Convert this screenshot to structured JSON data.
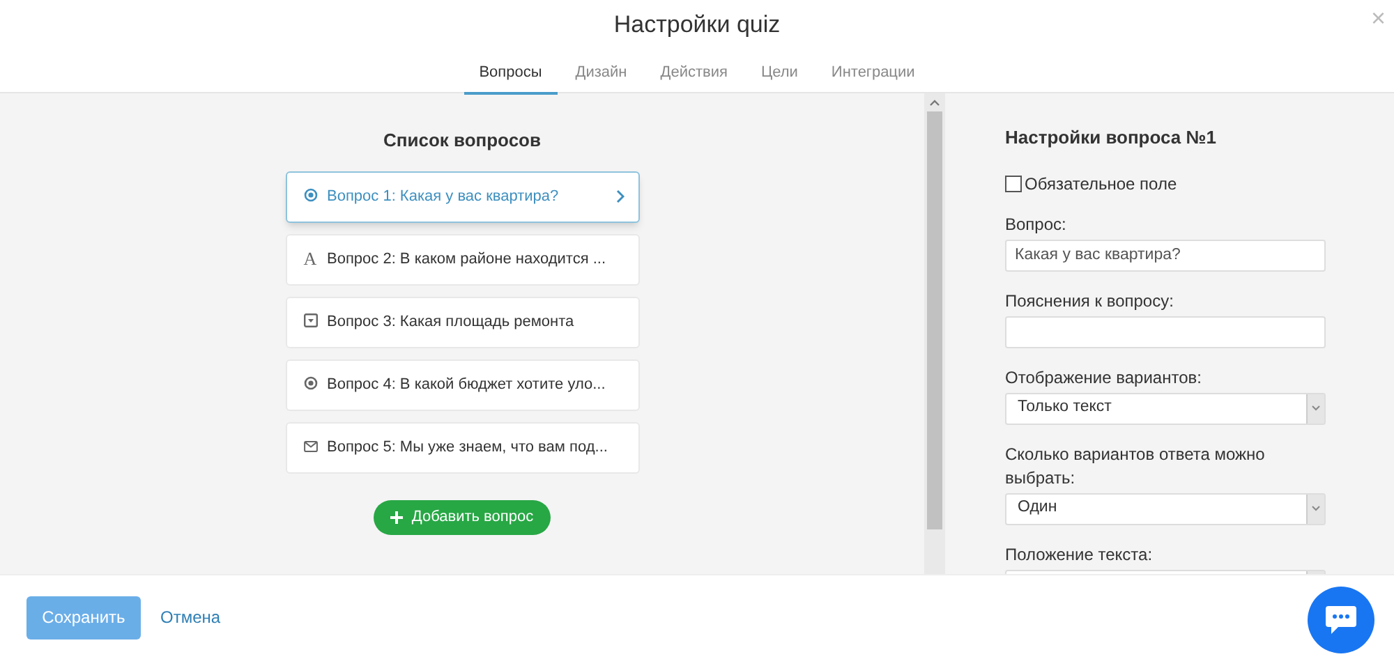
{
  "window": {
    "title": "Настройки quiz",
    "close": "×"
  },
  "tabs": [
    {
      "label": "Вопросы",
      "selected": true
    },
    {
      "label": "Дизайн",
      "selected": false
    },
    {
      "label": "Действия",
      "selected": false
    },
    {
      "label": "Цели",
      "selected": false
    },
    {
      "label": "Интеграции",
      "selected": false
    }
  ],
  "questions": {
    "title": "Список вопросов",
    "items": [
      {
        "kind": "radio",
        "label": "Вопрос 1: Какая у вас квартира?",
        "selected": true
      },
      {
        "kind": "text",
        "icon": "A",
        "label": "Вопрос 2: В каком районе находится ...",
        "selected": false
      },
      {
        "kind": "dropdown",
        "label": "Вопрос 3: Какая площадь ремонта",
        "selected": false
      },
      {
        "kind": "radio",
        "label": "Вопрос 4: В какой бюджет хотите уло...",
        "selected": false
      },
      {
        "kind": "email",
        "label": "Вопрос 5: Мы уже знаем, что вам под...",
        "selected": false
      }
    ],
    "add_button": "Добавить вопрос"
  },
  "settings": {
    "title": "Настройки вопроса №1",
    "required": {
      "label": "Обязательное поле",
      "checked": false
    },
    "fields": [
      {
        "kind": "input",
        "label": "Вопрос:",
        "value": "Какая у вас квартира?"
      },
      {
        "kind": "input",
        "label": "Пояснения к вопросу:"
      },
      {
        "kind": "select",
        "label": "Отображение вариантов:",
        "value": "Только текст"
      },
      {
        "kind": "select",
        "label": "Сколько вариантов ответа можно выбрать:",
        "value": "Один"
      },
      {
        "kind": "select",
        "label": "Положение текста:"
      }
    ]
  },
  "footer": {
    "save": "Сохранить",
    "cancel": "Отмена"
  }
}
